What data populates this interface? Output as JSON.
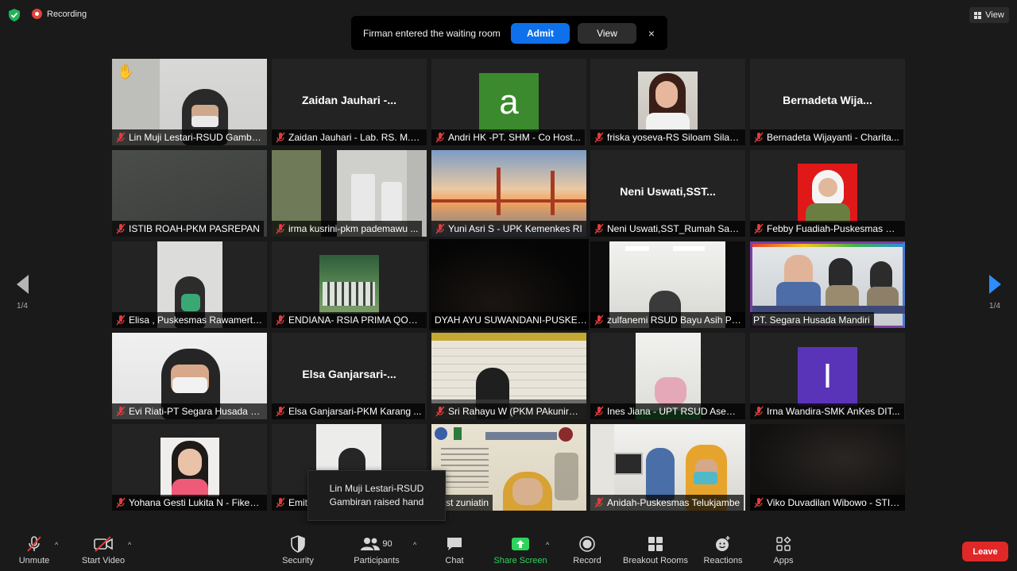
{
  "top": {
    "recording_label": "Recording",
    "view_label": "View"
  },
  "notice": {
    "text": "Firman entered the waiting room",
    "admit_label": "Admit",
    "view_label": "View",
    "close_label": "×"
  },
  "pager": {
    "left_label": "1/4",
    "right_label": "1/4"
  },
  "tiles": [
    {
      "name": "Lin Muji Lestari-RSUD Gambir...",
      "big": ""
    },
    {
      "name": "Zaidan Jauhari - Lab. RS. M.H...",
      "big": "Zaidan  Jauhari  -..."
    },
    {
      "name": "Andri HK -PT. SHM  - Co Host...",
      "big": "",
      "letter": "a"
    },
    {
      "name": "friska yoseva-RS Siloam Silam...",
      "big": ""
    },
    {
      "name": "Bernadeta Wijayanti - Charita...",
      "big": "Bernadeta  Wija..."
    },
    {
      "name": "ISTIB ROAH-PKM PASREPAN",
      "big": ""
    },
    {
      "name": "irma kusrini-pkm pademawu ...",
      "big": ""
    },
    {
      "name": "Yuni Asri S - UPK Kemenkes RI",
      "big": ""
    },
    {
      "name": "Neni Uswati,SST_Rumah Sakit ...",
      "big": "Neni  Uswati,SST..."
    },
    {
      "name": "Febby Fuadiah-Puskesmas Boj...",
      "big": ""
    },
    {
      "name": "Elisa , Puskesmas Rawamerta ...",
      "big": ""
    },
    {
      "name": "ENDIANA- RSIA PRIMA QONITA",
      "big": ""
    },
    {
      "name": "DYAH AYU SUWANDANI-PUSKES...",
      "big": ""
    },
    {
      "name": "zulfanemi RSUD Bayu Asih Pur...",
      "big": ""
    },
    {
      "name": "PT. Segara Husada Mandiri",
      "big": ""
    },
    {
      "name": "Evi Riati-PT Segara Husada M...",
      "big": ""
    },
    {
      "name": "Elsa Ganjarsari-PKM Karang ...",
      "big": "Elsa  Ganjarsari-..."
    },
    {
      "name": "Sri Rahayu W (PKM PAkuniran)",
      "big": ""
    },
    {
      "name": "Ines Jiana - UPT RSUD Asemb...",
      "big": ""
    },
    {
      "name": "Irna Wandira-SMK AnKes DIT...",
      "big": "",
      "letter": "I"
    },
    {
      "name": "Yohana Gesti Lukita N - Fikes ...",
      "big": ""
    },
    {
      "name": "Emit",
      "big": ""
    },
    {
      "name": "st zuniatin",
      "big": ""
    },
    {
      "name": "Anidah-Puskesmas Telukjambe",
      "big": ""
    },
    {
      "name": "Viko Duvadilan Wibowo - STIF...",
      "big": ""
    }
  ],
  "tooltip": {
    "text": "Lin Muji Lestari-RSUD Gambiran raised hand"
  },
  "toolbar": {
    "unmute": "Unmute",
    "start_video": "Start Video",
    "security": "Security",
    "participants": "Participants",
    "participants_count": "90",
    "chat": "Chat",
    "share_screen": "Share Screen",
    "record": "Record",
    "breakout_rooms": "Breakout Rooms",
    "reactions": "Reactions",
    "apps": "Apps",
    "leave": "Leave"
  },
  "colors": {
    "accent_blue": "#0e71eb",
    "share_green": "#2fd35b",
    "leave_red": "#e02828",
    "speaking_outline": "#c6d94a"
  }
}
